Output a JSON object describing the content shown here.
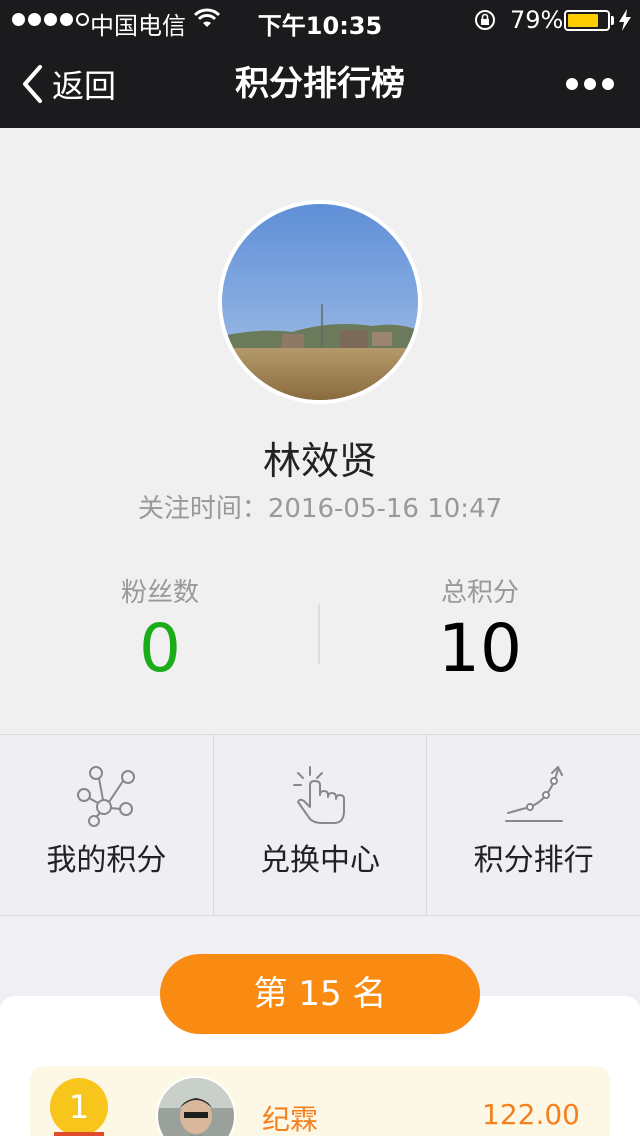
{
  "status_bar": {
    "signal_dots": 5,
    "signal_filled": 4,
    "carrier": "中国电信",
    "time": "下午10:35",
    "battery_percent": "79%",
    "battery_level": 0.79,
    "battery_color": "#ffcc00"
  },
  "nav": {
    "back_label": "返回",
    "title": "积分排行榜"
  },
  "profile": {
    "name": "林效贤",
    "follow_label": "关注时间：",
    "follow_time": "2016-05-16 10:47",
    "fans_label": "粉丝数",
    "fans_value": "0",
    "points_label": "总积分",
    "points_value": "10"
  },
  "menu": [
    {
      "label": "我的积分",
      "icon": "network-icon"
    },
    {
      "label": "兑换中心",
      "icon": "tap-hand-icon"
    },
    {
      "label": "积分排行",
      "icon": "trend-up-icon"
    }
  ],
  "ranking": {
    "my_rank_label": "第 15 名",
    "rows": [
      {
        "rank": "1",
        "name": "纪霖",
        "score": "122.00"
      }
    ]
  },
  "colors": {
    "nav_bg": "#1b1b1d",
    "accent_green": "#1aad19",
    "accent_orange": "#f98a12",
    "score_orange": "#f5811e"
  }
}
